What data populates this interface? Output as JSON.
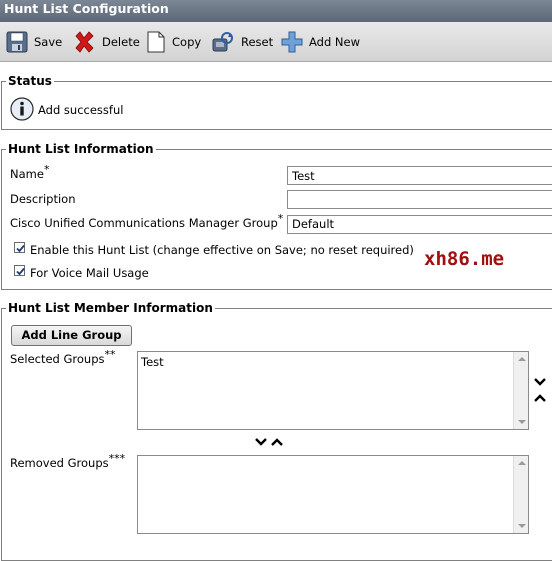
{
  "window": {
    "title": "Hunt List Configuration"
  },
  "toolbar": {
    "save_label": "Save",
    "delete_label": "Delete",
    "copy_label": "Copy",
    "reset_label": "Reset",
    "add_new_label": "Add New"
  },
  "status": {
    "legend": "Status",
    "message": "Add successful",
    "icon": "info-icon"
  },
  "hunt_list_info": {
    "legend": "Hunt List Information",
    "name_label": "Name",
    "name_value": "Test",
    "description_label": "Description",
    "description_value": "",
    "cucm_group_label": "Cisco Unified Communications Manager Group",
    "cucm_group_value": "Default",
    "required_marker": "*",
    "enable_label": "Enable this Hunt List (change effective on Save; no reset required)",
    "enable_checked": true,
    "voicemail_label": "For Voice Mail Usage",
    "voicemail_checked": true
  },
  "watermark": "xh86.me",
  "member_info": {
    "legend": "Hunt List Member Information",
    "add_line_group_label": "Add Line Group",
    "selected_groups_label": "Selected Groups",
    "selected_marker": "**",
    "selected_groups": [
      "Test"
    ],
    "removed_groups_label": "Removed Groups",
    "removed_marker": "***",
    "removed_groups": []
  },
  "colors": {
    "accent": "#5d6877",
    "watermark": "#a01010"
  }
}
